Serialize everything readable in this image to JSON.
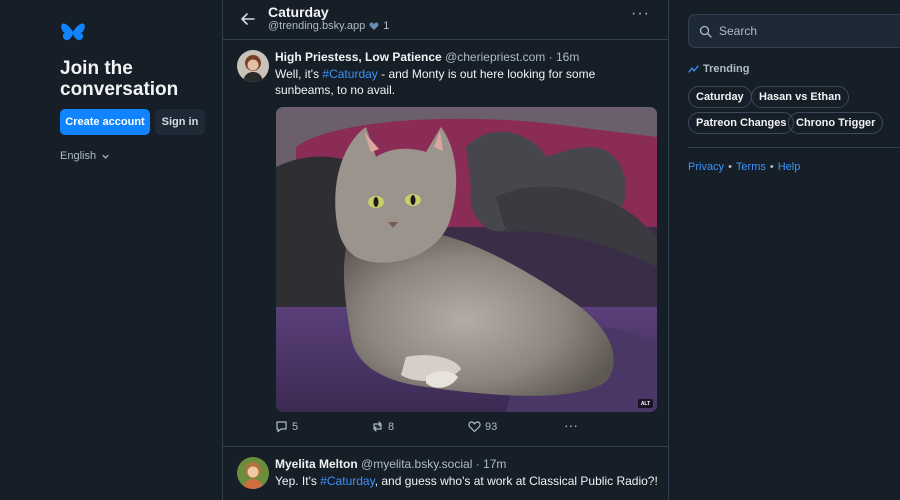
{
  "sidebar_left": {
    "title": "Join the conversation",
    "create_account_label": "Create account",
    "sign_in_label": "Sign in",
    "language": "English"
  },
  "feed": {
    "title": "Caturday",
    "handle": "@trending.bsky.app",
    "likes": "1"
  },
  "posts": [
    {
      "name": "High Priestess, Low Patience",
      "handle": "@cheriepriest.com",
      "time": "16m",
      "text_before": "Well, it's ",
      "hashtag": "#Caturday",
      "text_after": " - and Monty is out here looking for some sunbeams, to no avail.",
      "alt_label": "ALT",
      "replies": "5",
      "reposts": "8",
      "likes": "93"
    },
    {
      "name": "Myelita Melton",
      "handle": "@myelita.bsky.social",
      "time": "17m",
      "text_before": "Yep. It's ",
      "hashtag": "#Caturday",
      "text_after": ", and guess who's at work at Classical Public Radio?!"
    }
  ],
  "sidebar_right": {
    "search_placeholder": "Search",
    "trending_label": "Trending",
    "trending_topics": [
      "Caturday",
      "Hasan vs Ethan",
      "Patreon Changes",
      "Chrono Trigger"
    ],
    "footer_links": [
      "Privacy",
      "Terms",
      "Help"
    ],
    "footer_separator": "•"
  },
  "colors": {
    "background": "#161e27",
    "accent": "#1083fe",
    "link": "#3b94f6",
    "border": "#2e4052",
    "muted_text": "#aebbc9"
  }
}
